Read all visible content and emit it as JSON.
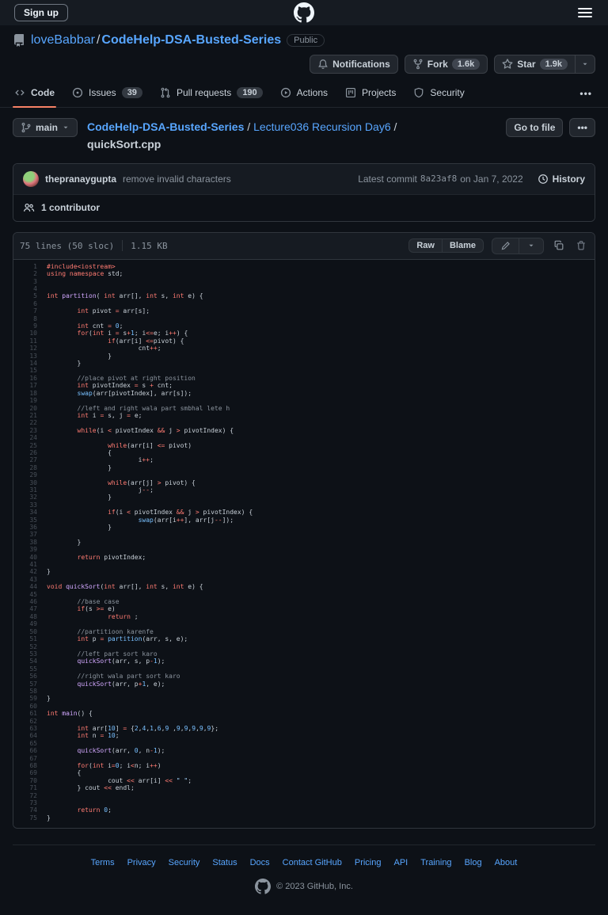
{
  "topbar": {
    "signup_label": "Sign up"
  },
  "repo": {
    "owner": "loveBabbar",
    "name": "CodeHelp-DSA-Busted-Series",
    "separator": "/",
    "visibility": "Public",
    "notifications_label": "Notifications",
    "fork_label": "Fork",
    "fork_count": "1.6k",
    "star_label": "Star",
    "star_count": "1.9k"
  },
  "tabs": [
    {
      "label": "Code"
    },
    {
      "label": "Issues",
      "count": "39"
    },
    {
      "label": "Pull requests",
      "count": "190"
    },
    {
      "label": "Actions"
    },
    {
      "label": "Projects"
    },
    {
      "label": "Security"
    }
  ],
  "tabs_overflow": "•••",
  "file_nav": {
    "branch": "main",
    "crumb_root": "CodeHelp-DSA-Busted-Series",
    "crumb_dir": "Lecture036 Recursion Day6",
    "crumb_sep1": " / ",
    "crumb_sep2": " / ",
    "file_name": "quickSort.cpp",
    "goto_button": "Go to file",
    "more_button": "•••"
  },
  "commit": {
    "author": "thepranaygupta",
    "message": "remove invalid characters",
    "latest_prefix": "Latest commit",
    "sha": "8a23af8",
    "date": "on Jan 7, 2022",
    "history_label": "History"
  },
  "contributors": {
    "label": "1 contributor"
  },
  "file": {
    "meta_lines": "75 lines (50 sloc)",
    "meta_size": "1.15 KB",
    "raw_label": "Raw",
    "blame_label": "Blame"
  },
  "code": {
    "language": "cpp",
    "lines": [
      [
        [
          "k",
          "#include"
        ],
        [
          "k",
          "<iostream>"
        ]
      ],
      [
        [
          "k",
          "using"
        ],
        [
          "p",
          " "
        ],
        [
          "k",
          "namespace"
        ],
        [
          "p",
          " std;"
        ]
      ],
      [],
      [],
      [
        [
          "k",
          "int"
        ],
        [
          "p",
          " "
        ],
        [
          "f",
          "partition"
        ],
        [
          "p",
          "( "
        ],
        [
          "k",
          "int"
        ],
        [
          "p",
          " arr[], "
        ],
        [
          "k",
          "int"
        ],
        [
          "p",
          " s, "
        ],
        [
          "k",
          "int"
        ],
        [
          "p",
          " e) {"
        ]
      ],
      [],
      [
        [
          "p",
          "        "
        ],
        [
          "k",
          "int"
        ],
        [
          "p",
          " pivot "
        ],
        [
          "o",
          "="
        ],
        [
          "p",
          " arr[s];"
        ]
      ],
      [],
      [
        [
          "p",
          "        "
        ],
        [
          "k",
          "int"
        ],
        [
          "p",
          " cnt "
        ],
        [
          "o",
          "="
        ],
        [
          "p",
          " "
        ],
        [
          "n",
          "0"
        ],
        [
          "p",
          ";"
        ]
      ],
      [
        [
          "p",
          "        "
        ],
        [
          "k",
          "for"
        ],
        [
          "p",
          "("
        ],
        [
          "k",
          "int"
        ],
        [
          "p",
          " i "
        ],
        [
          "o",
          "="
        ],
        [
          "p",
          " s"
        ],
        [
          "o",
          "+"
        ],
        [
          "n",
          "1"
        ],
        [
          "p",
          "; i"
        ],
        [
          "o",
          "<="
        ],
        [
          "p",
          "e; i"
        ],
        [
          "o",
          "++"
        ],
        [
          "p",
          ") {"
        ]
      ],
      [
        [
          "p",
          "                "
        ],
        [
          "k",
          "if"
        ],
        [
          "p",
          "(arr[i] "
        ],
        [
          "o",
          "<="
        ],
        [
          "p",
          "pivot) {"
        ]
      ],
      [
        [
          "p",
          "                        cnt"
        ],
        [
          "o",
          "++"
        ],
        [
          "p",
          ";"
        ]
      ],
      [
        [
          "p",
          "                }"
        ]
      ],
      [
        [
          "p",
          "        }"
        ]
      ],
      [],
      [
        [
          "p",
          "        "
        ],
        [
          "c",
          "//place pivot at right position"
        ]
      ],
      [
        [
          "p",
          "        "
        ],
        [
          "k",
          "int"
        ],
        [
          "p",
          " pivotIndex "
        ],
        [
          "o",
          "="
        ],
        [
          "p",
          " s "
        ],
        [
          "o",
          "+"
        ],
        [
          "p",
          " cnt;"
        ]
      ],
      [
        [
          "p",
          "        "
        ],
        [
          "b",
          "swap"
        ],
        [
          "p",
          "(arr[pivotIndex], arr[s]);"
        ]
      ],
      [],
      [
        [
          "p",
          "        "
        ],
        [
          "c",
          "//left and right wala part smbhal lete h"
        ]
      ],
      [
        [
          "p",
          "        "
        ],
        [
          "k",
          "int"
        ],
        [
          "p",
          " i "
        ],
        [
          "o",
          "="
        ],
        [
          "p",
          " s, j "
        ],
        [
          "o",
          "="
        ],
        [
          "p",
          " e;"
        ]
      ],
      [],
      [
        [
          "p",
          "        "
        ],
        [
          "k",
          "while"
        ],
        [
          "p",
          "(i "
        ],
        [
          "o",
          "<"
        ],
        [
          "p",
          " pivotIndex "
        ],
        [
          "o",
          "&&"
        ],
        [
          "p",
          " j "
        ],
        [
          "o",
          ">"
        ],
        [
          "p",
          " pivotIndex) {"
        ]
      ],
      [],
      [
        [
          "p",
          "                "
        ],
        [
          "k",
          "while"
        ],
        [
          "p",
          "(arr[i] "
        ],
        [
          "o",
          "<="
        ],
        [
          "p",
          " pivot)"
        ]
      ],
      [
        [
          "p",
          "                {"
        ]
      ],
      [
        [
          "p",
          "                        i"
        ],
        [
          "o",
          "++"
        ],
        [
          "p",
          ";"
        ]
      ],
      [
        [
          "p",
          "                }"
        ]
      ],
      [],
      [
        [
          "p",
          "                "
        ],
        [
          "k",
          "while"
        ],
        [
          "p",
          "(arr[j] "
        ],
        [
          "o",
          ">"
        ],
        [
          "p",
          " pivot) {"
        ]
      ],
      [
        [
          "p",
          "                        j"
        ],
        [
          "o",
          "--"
        ],
        [
          "p",
          ";"
        ]
      ],
      [
        [
          "p",
          "                }"
        ]
      ],
      [],
      [
        [
          "p",
          "                "
        ],
        [
          "k",
          "if"
        ],
        [
          "p",
          "(i "
        ],
        [
          "o",
          "<"
        ],
        [
          "p",
          " pivotIndex "
        ],
        [
          "o",
          "&&"
        ],
        [
          "p",
          " j "
        ],
        [
          "o",
          ">"
        ],
        [
          "p",
          " pivotIndex) {"
        ]
      ],
      [
        [
          "p",
          "                        "
        ],
        [
          "b",
          "swap"
        ],
        [
          "p",
          "(arr[i"
        ],
        [
          "o",
          "++"
        ],
        [
          "p",
          "], arr[j"
        ],
        [
          "o",
          "--"
        ],
        [
          "p",
          "]);"
        ]
      ],
      [
        [
          "p",
          "                }"
        ]
      ],
      [],
      [
        [
          "p",
          "        }"
        ]
      ],
      [],
      [
        [
          "p",
          "        "
        ],
        [
          "k",
          "return"
        ],
        [
          "p",
          " pivotIndex;"
        ]
      ],
      [],
      [
        [
          "p",
          "}"
        ]
      ],
      [],
      [
        [
          "k",
          "void"
        ],
        [
          "p",
          " "
        ],
        [
          "f",
          "quickSort"
        ],
        [
          "p",
          "("
        ],
        [
          "k",
          "int"
        ],
        [
          "p",
          " arr[], "
        ],
        [
          "k",
          "int"
        ],
        [
          "p",
          " s, "
        ],
        [
          "k",
          "int"
        ],
        [
          "p",
          " e) {"
        ]
      ],
      [],
      [
        [
          "p",
          "        "
        ],
        [
          "c",
          "//base case"
        ]
      ],
      [
        [
          "p",
          "        "
        ],
        [
          "k",
          "if"
        ],
        [
          "p",
          "(s "
        ],
        [
          "o",
          ">="
        ],
        [
          "p",
          " e)"
        ]
      ],
      [
        [
          "p",
          "                "
        ],
        [
          "k",
          "return"
        ],
        [
          "p",
          " ;"
        ]
      ],
      [],
      [
        [
          "p",
          "        "
        ],
        [
          "c",
          "//partitioon karenfe"
        ]
      ],
      [
        [
          "p",
          "        "
        ],
        [
          "k",
          "int"
        ],
        [
          "p",
          " p "
        ],
        [
          "o",
          "="
        ],
        [
          "p",
          " "
        ],
        [
          "b",
          "partition"
        ],
        [
          "p",
          "(arr, s, e);"
        ]
      ],
      [],
      [
        [
          "p",
          "        "
        ],
        [
          "c",
          "//left part sort karo"
        ]
      ],
      [
        [
          "p",
          "        "
        ],
        [
          "f",
          "quickSort"
        ],
        [
          "p",
          "(arr, s, p"
        ],
        [
          "o",
          "-"
        ],
        [
          "n",
          "1"
        ],
        [
          "p",
          ");"
        ]
      ],
      [],
      [
        [
          "p",
          "        "
        ],
        [
          "c",
          "//right wala part sort karo"
        ]
      ],
      [
        [
          "p",
          "        "
        ],
        [
          "f",
          "quickSort"
        ],
        [
          "p",
          "(arr, p"
        ],
        [
          "o",
          "+"
        ],
        [
          "n",
          "1"
        ],
        [
          "p",
          ", e);"
        ]
      ],
      [],
      [
        [
          "p",
          "}"
        ]
      ],
      [],
      [
        [
          "k",
          "int"
        ],
        [
          "p",
          " "
        ],
        [
          "f",
          "main"
        ],
        [
          "p",
          "() {"
        ]
      ],
      [],
      [
        [
          "p",
          "        "
        ],
        [
          "k",
          "int"
        ],
        [
          "p",
          " arr["
        ],
        [
          "n",
          "10"
        ],
        [
          "p",
          "] "
        ],
        [
          "o",
          "="
        ],
        [
          "p",
          " {"
        ],
        [
          "n",
          "2"
        ],
        [
          "p",
          ","
        ],
        [
          "n",
          "4"
        ],
        [
          "p",
          ","
        ],
        [
          "n",
          "1"
        ],
        [
          "p",
          ","
        ],
        [
          "n",
          "6"
        ],
        [
          "p",
          ","
        ],
        [
          "n",
          "9"
        ],
        [
          "p",
          " ,"
        ],
        [
          "n",
          "9"
        ],
        [
          "p",
          ","
        ],
        [
          "n",
          "9"
        ],
        [
          "p",
          ","
        ],
        [
          "n",
          "9"
        ],
        [
          "p",
          ","
        ],
        [
          "n",
          "9"
        ],
        [
          "p",
          ","
        ],
        [
          "n",
          "9"
        ],
        [
          "p",
          "};"
        ]
      ],
      [
        [
          "p",
          "        "
        ],
        [
          "k",
          "int"
        ],
        [
          "p",
          " n "
        ],
        [
          "o",
          "="
        ],
        [
          "p",
          " "
        ],
        [
          "n",
          "10"
        ],
        [
          "p",
          ";"
        ]
      ],
      [],
      [
        [
          "p",
          "        "
        ],
        [
          "f",
          "quickSort"
        ],
        [
          "p",
          "(arr, "
        ],
        [
          "n",
          "0"
        ],
        [
          "p",
          ", n"
        ],
        [
          "o",
          "-"
        ],
        [
          "n",
          "1"
        ],
        [
          "p",
          ");"
        ]
      ],
      [],
      [
        [
          "p",
          "        "
        ],
        [
          "k",
          "for"
        ],
        [
          "p",
          "("
        ],
        [
          "k",
          "int"
        ],
        [
          "p",
          " i"
        ],
        [
          "o",
          "="
        ],
        [
          "n",
          "0"
        ],
        [
          "p",
          "; i"
        ],
        [
          "o",
          "<"
        ],
        [
          "p",
          "n; i"
        ],
        [
          "o",
          "++"
        ],
        [
          "p",
          ")"
        ]
      ],
      [
        [
          "p",
          "        {"
        ]
      ],
      [
        [
          "p",
          "                cout "
        ],
        [
          "o",
          "<<"
        ],
        [
          "p",
          " arr[i] "
        ],
        [
          "o",
          "<<"
        ],
        [
          "p",
          " "
        ],
        [
          "s",
          "\" \""
        ],
        [
          "p",
          ";"
        ]
      ],
      [
        [
          "p",
          "        } cout "
        ],
        [
          "o",
          "<<"
        ],
        [
          "p",
          " endl;"
        ]
      ],
      [],
      [],
      [
        [
          "p",
          "        "
        ],
        [
          "k",
          "return"
        ],
        [
          "p",
          " "
        ],
        [
          "n",
          "0"
        ],
        [
          "p",
          ";"
        ]
      ],
      [
        [
          "p",
          "}"
        ]
      ]
    ]
  },
  "footer": {
    "links": [
      "Terms",
      "Privacy",
      "Security",
      "Status",
      "Docs",
      "Contact GitHub",
      "Pricing",
      "API",
      "Training",
      "Blog",
      "About"
    ],
    "copyright": "© 2023 GitHub, Inc."
  },
  "colors": {
    "page_bg": "#0d1117",
    "header_bg": "#161b22",
    "border": "#30363d",
    "link_blue": "#58a6ff",
    "tab_accent_orange": "#f78166",
    "syntax_keyword": "#ff7b72",
    "syntax_constant": "#79c0ff",
    "syntax_function": "#d2a8ff",
    "syntax_string": "#a5d6ff",
    "syntax_comment": "#8b949e"
  }
}
